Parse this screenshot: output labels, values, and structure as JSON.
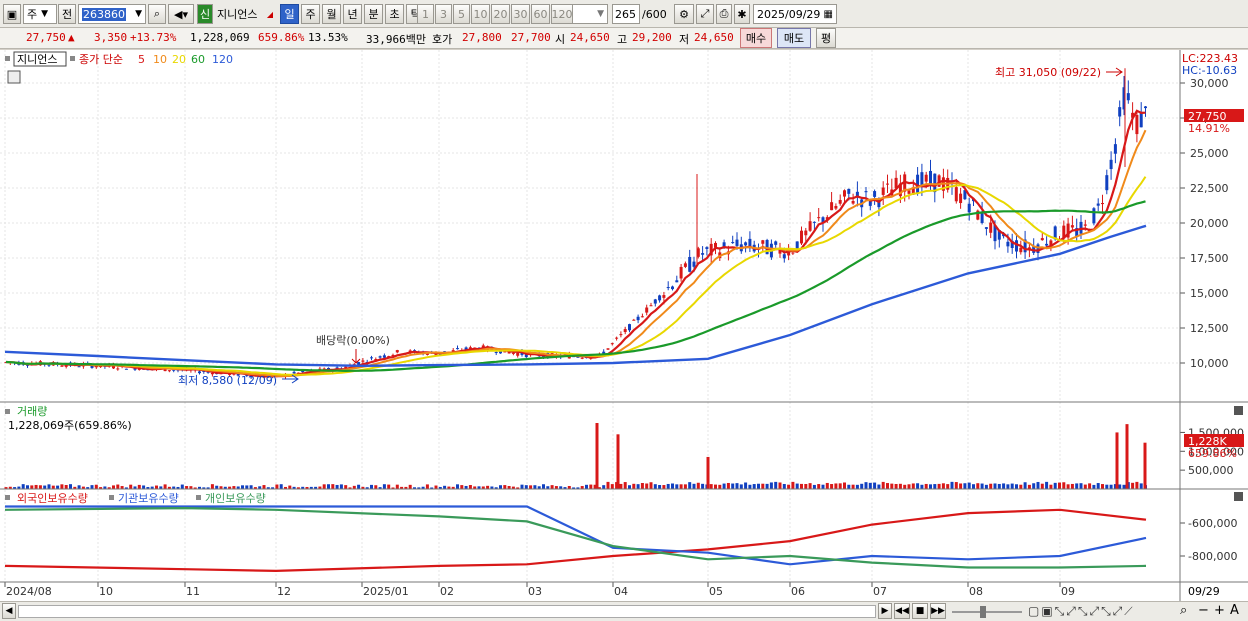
{
  "toolbar": {
    "market_type": "주",
    "prev_label": "전",
    "code": "263860",
    "badge": "신",
    "stock_name": "지니언스",
    "period_tabs": [
      "일",
      "주",
      "월",
      "년",
      "분",
      "초",
      "틱"
    ],
    "active_period": "일",
    "intervals": [
      "1",
      "3",
      "5",
      "10",
      "20",
      "30",
      "60",
      "120"
    ],
    "count": "265",
    "count_total": "/600",
    "date": "2025/09/29"
  },
  "quote": {
    "price": "27,750",
    "arrow": "▲",
    "change": "3,350",
    "change_pct": "+13.73%",
    "volume": "1,228,069",
    "volume_ratio": "659.86%",
    "turnover": "13.53%",
    "amount": "33,966백만",
    "hoga_label": "호가",
    "ask": "27,800",
    "bid": "27,700",
    "open_label": "시",
    "open": "24,650",
    "high_label": "고",
    "high": "29,200",
    "low_label": "저",
    "low": "24,650",
    "buy_label": "매수",
    "sell_label": "매도",
    "extra_label": "평"
  },
  "price_panel": {
    "legend_name": "지니언스",
    "legend_type": "종가 단순",
    "ma_labels": [
      "5",
      "10",
      "20",
      "60",
      "120"
    ],
    "lc": "LC:223.43",
    "hc": "HC:-10.63",
    "last_price": "27,750",
    "last_pct": "14.91%",
    "max_annotation": "최고 31,050 (09/22)",
    "min_annotation": "최저 8,580 (12/09)",
    "dividend_annotation": "배당락(0.00%)"
  },
  "volume_panel": {
    "title": "거래량",
    "value": "1,228,069주(659.86%)",
    "last_value": "1,228K",
    "last_pct": "659.86%"
  },
  "holding_panel": {
    "foreign_label": "외국인보유수량",
    "inst_label": "기관보유수량",
    "indiv_label": "개인보유수량"
  },
  "x_axis": {
    "labels": [
      "2024/08",
      "10",
      "11",
      "12",
      "2025/01",
      "02",
      "03",
      "04",
      "05",
      "06",
      "07",
      "08",
      "09"
    ],
    "right_label": "09/29"
  },
  "colors": {
    "up": "#d81818",
    "down": "#1040c0",
    "ma5": "#d81818",
    "ma10": "#f08a1a",
    "ma20": "#e8d800",
    "ma60": "#1a9a2a",
    "ma120": "#2c5ad8",
    "foreign": "#d81818",
    "inst": "#2c5ad8",
    "indiv": "#3a9a5a"
  },
  "chart_data": [
    {
      "type": "line",
      "title": "",
      "x_label_note": "daily candles, Aug 2024 - Sep 29 2025",
      "x": [
        "2024/08",
        "2024/09",
        "2024/10",
        "2024/11",
        "2024/12",
        "2025/01",
        "2025/02",
        "2025/03",
        "2025/04",
        "2025/05",
        "2025/06",
        "2025/07",
        "2025/08",
        "2025/09",
        "2025/09/29"
      ],
      "series": [
        {
          "name": "close",
          "values": [
            10050,
            9900,
            9700,
            9350,
            9100,
            10100,
            10800,
            10500,
            11800,
            17300,
            19800,
            21800,
            18600,
            24900,
            27750
          ]
        },
        {
          "name": "120",
          "values": [
            10800,
            10500,
            10200,
            9900,
            9800,
            9850,
            9900,
            10000,
            10300,
            12000,
            14200,
            16400,
            17800,
            19000,
            19800
          ]
        }
      ],
      "ylim": [
        7500,
        32500
      ],
      "yticks": [
        10000,
        12500,
        15000,
        17500,
        20000,
        22500,
        25000,
        27500,
        30000
      ],
      "annotations": {
        "max": {
          "value": 31050,
          "date": "09/22"
        },
        "min": {
          "value": 8580,
          "date": "12/09"
        }
      }
    },
    {
      "type": "bar",
      "title": "거래량",
      "yticks": [
        500000,
        1000000,
        1500000
      ],
      "ylim": [
        0,
        1800000
      ],
      "spikes": [
        {
          "date": "2025/03",
          "value": 1750000
        },
        {
          "date": "2025/04",
          "value": 1450000
        },
        {
          "date": "2025/05",
          "value": 850000
        },
        {
          "date": "2025/09",
          "value": 1500000
        },
        {
          "date": "2025/09",
          "value": 1720000
        },
        {
          "date": "2025/09/29",
          "value": 1228069
        }
      ]
    },
    {
      "type": "line",
      "title": "외국인보유수량 / 기관보유수량 / 개인보유수량",
      "yticks": [
        -600000,
        -800000
      ],
      "x": [
        "2024/08",
        "2024/10",
        "2024/12",
        "2025/02",
        "2025/03",
        "2025/04",
        "2025/05",
        "2025/06",
        "2025/07",
        "2025/08",
        "2025/09",
        "2025/09/29"
      ],
      "series": [
        {
          "name": "외국인보유수량",
          "values": [
            -860000,
            -880000,
            -890000,
            -860000,
            -850000,
            -800000,
            -760000,
            -710000,
            -610000,
            -540000,
            -520000,
            -580000
          ]
        },
        {
          "name": "기관보유수량",
          "values": [
            -500000,
            -500000,
            -500000,
            -500000,
            -500000,
            -750000,
            -780000,
            -850000,
            -800000,
            -820000,
            -800000,
            -690000
          ]
        },
        {
          "name": "개인보유수량",
          "values": [
            -520000,
            -510000,
            -520000,
            -560000,
            -590000,
            -740000,
            -820000,
            -800000,
            -840000,
            -870000,
            -870000,
            -860000
          ]
        }
      ]
    }
  ]
}
